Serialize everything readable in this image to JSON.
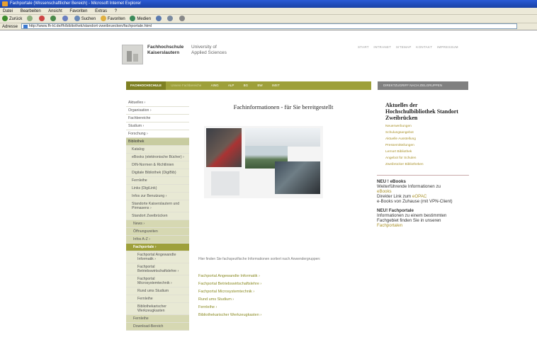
{
  "window": {
    "title": "Fachportale (Wissenschaftlicher Bereich) - Microsoft Internet Explorer"
  },
  "menu": [
    "Datei",
    "Bearbeiten",
    "Ansicht",
    "Favoriten",
    "Extras",
    "?"
  ],
  "toolbar": {
    "back": "Zurück",
    "search": "Suchen",
    "favorites": "Favoriten",
    "media": "Medien"
  },
  "address": {
    "label": "Adresse",
    "url": "http://www.fh-kl.de/fh/bibliothek/standort-zweibruecken/fachportale.html"
  },
  "brand": {
    "line1": "Fachhochschule",
    "line2": "Kaiserslautern",
    "sub1": "University of",
    "sub2": "Applied Sciences"
  },
  "toplinks": [
    "START",
    "INTRANET",
    "SITEMAP",
    "KONTAKT",
    "IMPRESSUM"
  ],
  "mainnav": [
    "FACHHOCHSCHULE",
    "Unsere Fachbereiche",
    "AING",
    "ALP",
    "BG",
    "BW",
    "IMST"
  ],
  "rightnav": "DIREKTZUGRIFF NACH ZIELGRUPPEN",
  "sidebar": [
    {
      "label": "Aktuelles ›",
      "level": "sb"
    },
    {
      "label": "Organisation ›",
      "level": "sb"
    },
    {
      "label": "Fachbereiche",
      "level": "sb"
    },
    {
      "label": "Studium ›",
      "level": "sb"
    },
    {
      "label": "Forschung ›",
      "level": "sb"
    },
    {
      "label": "Bibliothek",
      "level": "hl"
    },
    {
      "label": "Katalog",
      "level": "l1"
    },
    {
      "label": "eBooks (elektronische Bücher) ›",
      "level": "l1"
    },
    {
      "label": "DIN-Normen & Richtlinien",
      "level": "l1"
    },
    {
      "label": "Digitale Bibliothek (DigiBib)",
      "level": "l1"
    },
    {
      "label": "Fernleihe",
      "level": "l1"
    },
    {
      "label": "Links (DigiLink)",
      "level": "l1"
    },
    {
      "label": "Infos zur Benutzung ›",
      "level": "l1"
    },
    {
      "label": "Standorte Kaiserslautern und Pirmasens ›",
      "level": "l1"
    },
    {
      "label": "Standort Zweibrücken",
      "level": "l2"
    },
    {
      "label": "News ›",
      "level": "l2b"
    },
    {
      "label": "Öffnungszeiten",
      "level": "l2b"
    },
    {
      "label": "Infos A-Z ›",
      "level": "l2b"
    },
    {
      "label": "Fachportale ›",
      "level": "l2a"
    },
    {
      "label": "Fachportal Angewandte Informatik ›",
      "level": "l3"
    },
    {
      "label": "Fachportal Betriebswirtschaftslehre ›",
      "level": "l3"
    },
    {
      "label": "Fachportal Microsystemtechnik ›",
      "level": "l3"
    },
    {
      "label": "Rund ums Studium",
      "level": "l3"
    },
    {
      "label": "Fernleihe",
      "level": "l3"
    },
    {
      "label": "Bibliothekarischer Werkzeugkasten",
      "level": "l3"
    },
    {
      "label": "Fernleihe",
      "level": "l2b"
    },
    {
      "label": "Download-Bereich",
      "level": "l2b"
    }
  ],
  "content": {
    "title": "Fachinformationen - für Sie bereitgestellt",
    "intro": "Hier finden Sie fachspezifische Informationen sortiert nach Anwendergruppen:",
    "links": [
      "Fachportal Angewandte Informatik ›",
      "Fachportal Betriebswirtschaftslehre ›",
      "Fachportal Microsystemtechnik ›",
      "Rund ums Studium ›",
      "Fernleihe ›",
      "Bibliothekarischer Werkzeugkasten ›"
    ]
  },
  "right": {
    "heading": "Aktuelles der Hochschulbibliothek Standort Zweibrücken",
    "links": [
      "Neuerwerbungen",
      "Schulungsangebot",
      "Aktuelle Ausstellung",
      "Pressemitteilungen",
      "Lernort Bibliothek",
      "Angebot für Schulen",
      "Zweibrücker Bibliotheken"
    ],
    "ebooks_title": "NEU ! eBooks",
    "ebooks_text1": "Weiterführende Informationen zu",
    "ebooks_link1": "eBooks",
    "ebooks_text2": "Direkter Link zum",
    "ebooks_link2": "eOPAC",
    "ebooks_text3": "e-Books von Zuhause (mit VPN-Client)",
    "fp_title": "NEU! Fachportale",
    "fp_text": "Informationen zu einem bestimmten Fachgebiet finden Sie in unseren",
    "fp_link": "Fachportalen"
  }
}
